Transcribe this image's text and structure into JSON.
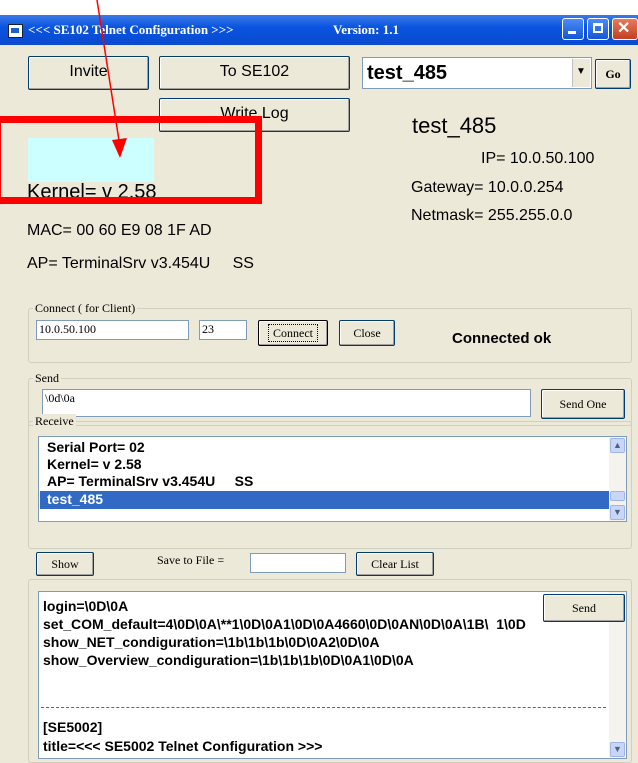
{
  "window": {
    "title": "<<< SE102 Telnet Configuration >>>",
    "version": "Version: 1.1"
  },
  "toolbar": {
    "invite_label": "Invite",
    "to_device_label": "To SE102",
    "write_log_label": "Write Log",
    "device_combo_value": "test_485",
    "go_label": "Go"
  },
  "device_info": {
    "kernel": "Kernel= v 2.58",
    "mac": "MAC= 00 60 E9 08 1F AD",
    "ap": "AP= TerminalSrv v3.454U     SS",
    "name": "test_485",
    "ip": "IP= 10.0.50.100",
    "gateway": "Gateway= 10.0.0.254",
    "netmask": "Netmask= 255.255.0.0"
  },
  "connect": {
    "group_title": "Connect ( for Client)",
    "host_value": "10.0.50.100",
    "port_value": "23",
    "connect_label": "Connect",
    "close_label": "Close",
    "status": "Connected ok"
  },
  "send": {
    "group_title": "Send",
    "input_value": "\\0d\\0a",
    "send_one_label": "Send One"
  },
  "receive": {
    "group_title": "Receive",
    "items": [
      "Serial Port= 02",
      "Kernel= v 2.58",
      "AP= TerminalSrv v3.454U     SS",
      "test_485"
    ],
    "selected_index": 3,
    "show_label": "Show",
    "save_to_file_label": "Save to File =",
    "save_to_file_value": "",
    "clear_list_label": "Clear List"
  },
  "script": {
    "send_label": "Send",
    "lines": [
      "login=\\0D\\0A",
      "set_COM_default=4\\0D\\0A\\**1\\0D\\0A1\\0D\\0A4660\\0D\\0AN\\0D\\0A\\1B\\  1\\0D",
      "show_NET_condiguration=\\1b\\1b\\1b\\0D\\0A2\\0D\\0A",
      "show_Overview_condiguration=\\1b\\1b\\1b\\0D\\0A1\\0D\\0A",
      "",
      "",
      "[SE5002]",
      "title=<<< SE5002 Telnet Configuration >>>"
    ]
  },
  "annotation": {
    "highlight_color": "#ff0000",
    "arrow_color": "#ff0000",
    "placeholder_fill": "#ccffff"
  }
}
